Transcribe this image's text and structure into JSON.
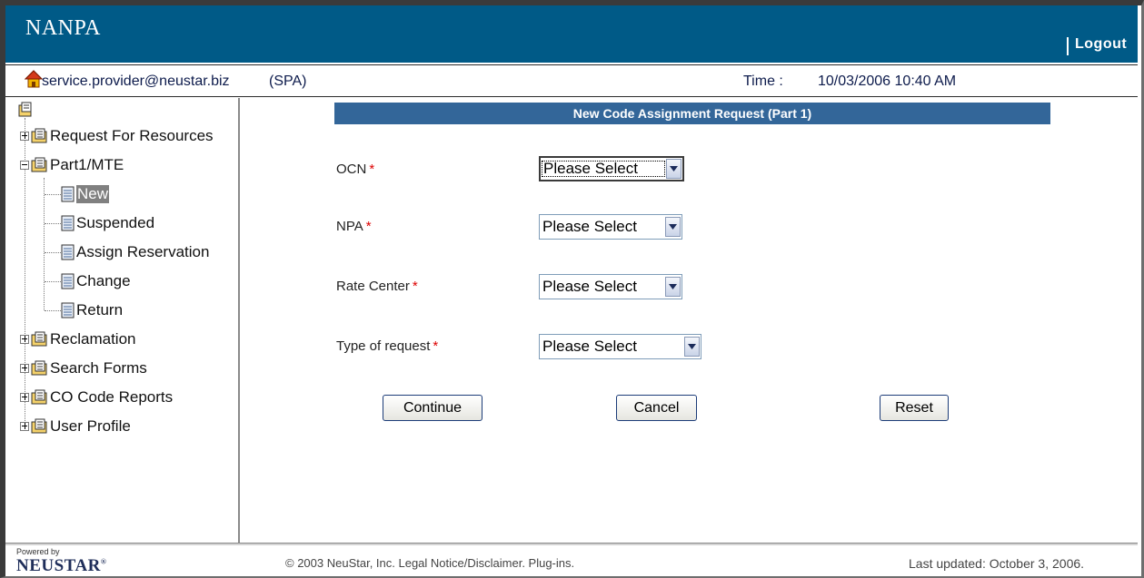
{
  "header": {
    "brand": "NANPA",
    "logout_label": "Logout"
  },
  "user_bar": {
    "home_icon": "home-icon",
    "email": "service.provider@neustar.biz",
    "role": "(SPA)",
    "time_label": "Time :",
    "time_value": "10/03/2006 10:40 AM"
  },
  "sidebar": {
    "items": [
      {
        "label": "Request For Resources",
        "icon": "folder-icon",
        "expander": "plus"
      },
      {
        "label": "Part1/MTE",
        "icon": "folder-icon",
        "expander": "minus"
      },
      {
        "label": "New",
        "icon": "document-icon",
        "selected": true
      },
      {
        "label": "Suspended",
        "icon": "document-icon"
      },
      {
        "label": "Assign Reservation",
        "icon": "document-icon"
      },
      {
        "label": "Change",
        "icon": "document-icon"
      },
      {
        "label": "Return",
        "icon": "document-icon"
      },
      {
        "label": "Reclamation",
        "icon": "folder-icon",
        "expander": "plus"
      },
      {
        "label": "Search Forms",
        "icon": "folder-icon",
        "expander": "plus"
      },
      {
        "label": "CO Code Reports",
        "icon": "folder-icon",
        "expander": "plus"
      },
      {
        "label": "User Profile",
        "icon": "folder-icon",
        "expander": "plus"
      }
    ]
  },
  "form": {
    "title": "New Code Assignment Request (Part 1)",
    "required_marker": "*",
    "fields": [
      {
        "label": "OCN",
        "value": "Please Select"
      },
      {
        "label": "NPA",
        "value": "Please Select"
      },
      {
        "label": "Rate Center",
        "value": "Please Select"
      },
      {
        "label": "Type of request",
        "value": "Please Select"
      }
    ],
    "buttons": {
      "continue": "Continue",
      "cancel": "Cancel",
      "reset": "Reset"
    }
  },
  "footer": {
    "powered_by": "Powered by",
    "logo_text": "NEUSTAR",
    "logo_mark": "®",
    "copyright": "© 2003 NeuStar, Inc. Legal Notice/Disclaimer. Plug-ins.",
    "last_updated": "Last updated: October 3, 2006."
  },
  "colors": {
    "banner": "#005a87",
    "form_header": "#336699",
    "required": "#dd0000"
  }
}
